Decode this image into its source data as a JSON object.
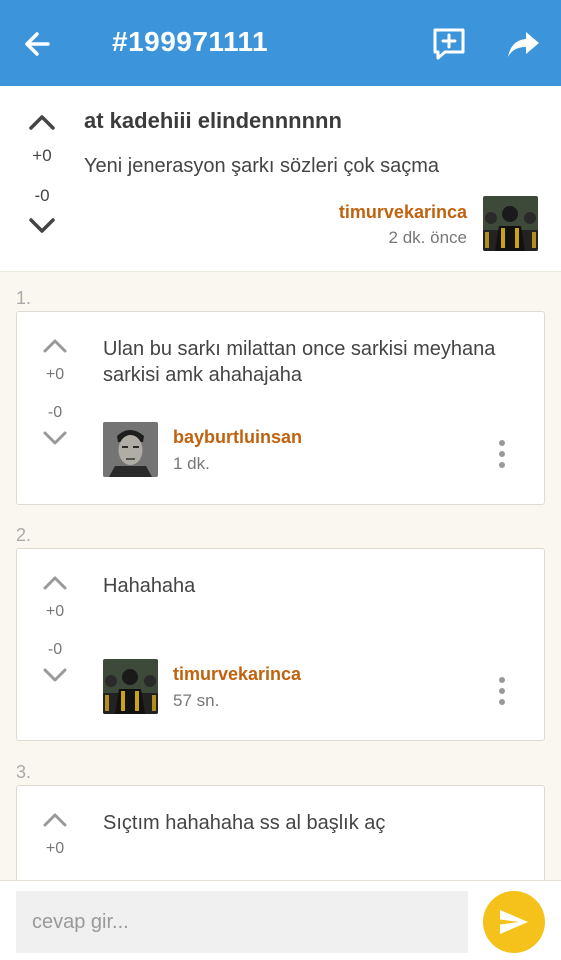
{
  "header": {
    "title": "#199971111",
    "back_icon": "arrow-left-icon",
    "add_entry_icon": "add-comment-icon",
    "share_icon": "share-icon",
    "background": "#3c94da"
  },
  "question": {
    "title": "at kadehiii elindennnnnn",
    "body": "Yeni jenerasyon şarkı sözleri çok saçma",
    "upvotes": "+0",
    "downvotes": "-0",
    "author": "timurvekarinca",
    "time": "2 dk. önce"
  },
  "answers": [
    {
      "number": "1.",
      "text": "Ulan bu sarkı milattan once sarkisi meyhana sarkisi amk ahahajaha",
      "upvotes": "+0",
      "downvotes": "-0",
      "author": "bayburtluinsan",
      "time": "1 dk."
    },
    {
      "number": "2.",
      "text": "Hahahaha",
      "upvotes": "+0",
      "downvotes": "-0",
      "author": "timurvekarinca",
      "time": "57 sn."
    },
    {
      "number": "3.",
      "text": "Sıçtım hahahaha ss al başlık aç",
      "upvotes": "+0"
    }
  ],
  "reply": {
    "placeholder": "cevap gir...",
    "send_icon": "send-icon",
    "send_color": "#f5c21b"
  },
  "colors": {
    "author": "#c0620e",
    "page_background": "#faf7f0"
  }
}
